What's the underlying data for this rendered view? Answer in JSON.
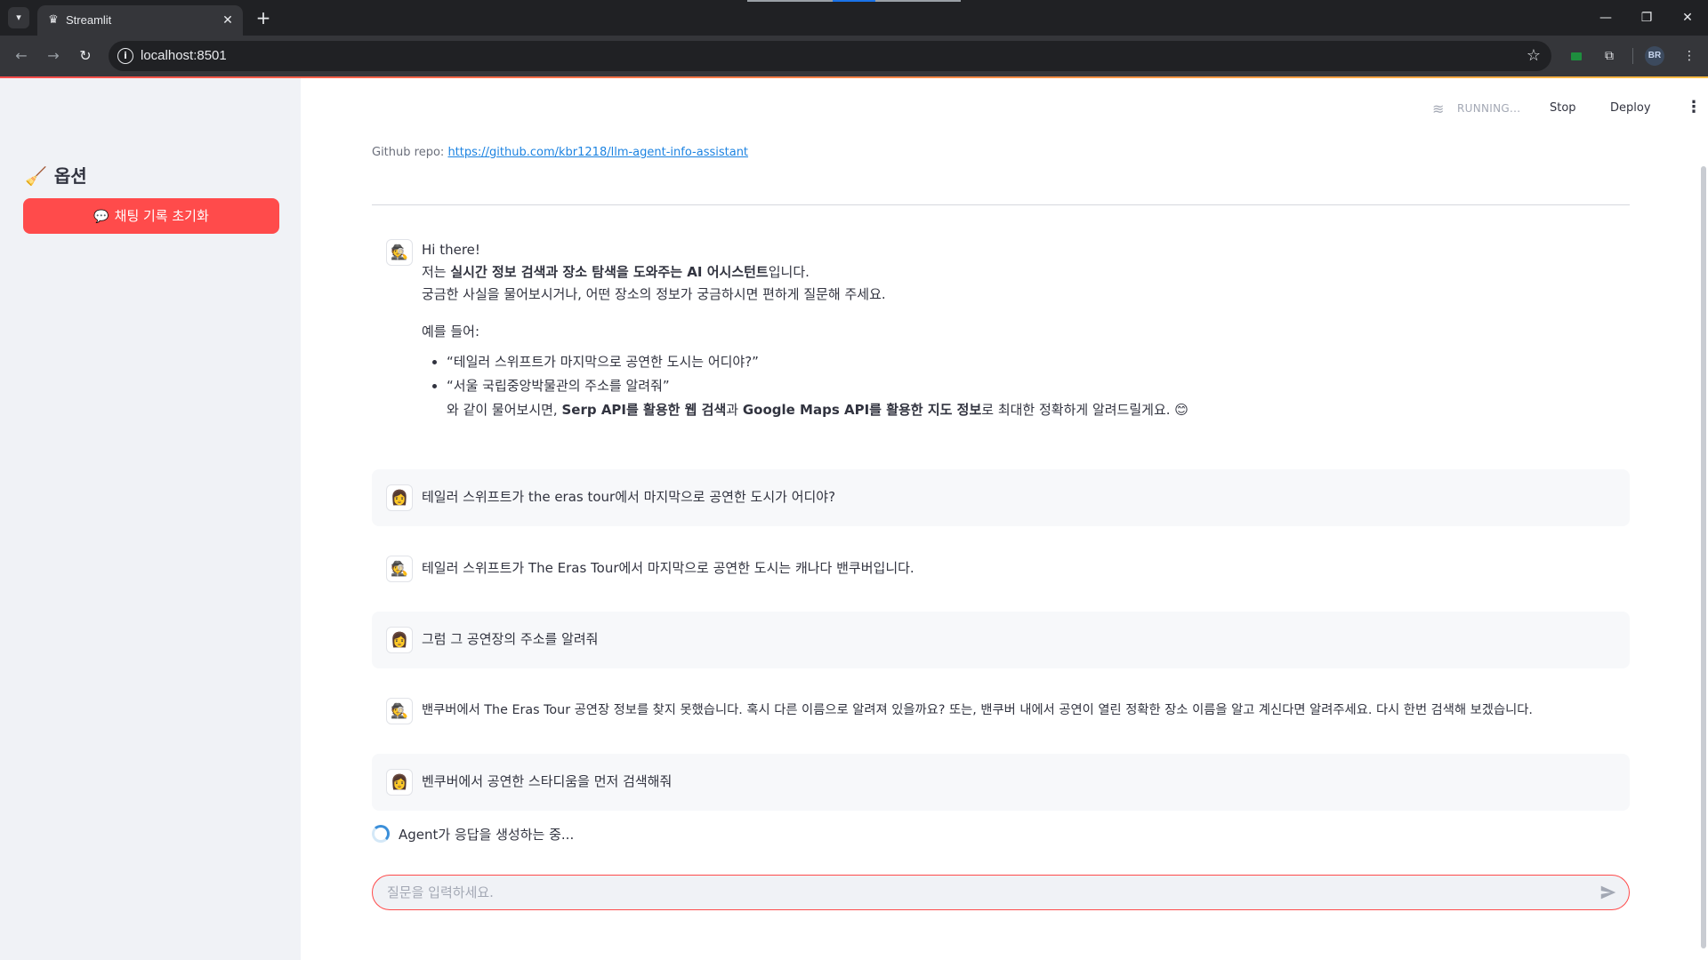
{
  "browser": {
    "tab_title": "Streamlit",
    "url": "localhost:8501",
    "profile_initials": "BR"
  },
  "sidebar": {
    "header": "옵션",
    "header_icon": "broom-icon",
    "reset_button_label": "채팅 기록 초기화",
    "reset_button_icon": "speech-balloon-icon"
  },
  "header": {
    "status": "RUNNING...",
    "stop_label": "Stop",
    "deploy_label": "Deploy"
  },
  "repo": {
    "label": "Github repo:",
    "link": "https://github.com/kbr1218/llm-agent-info-assistant"
  },
  "intro": {
    "greeting": "Hi there!",
    "line1_prefix": "저는 ",
    "line1_bold": "실시간 정보 검색과 장소 탐색을 도와주는 AI 어시스턴트",
    "line1_suffix": "입니다.",
    "line2": "궁금한 사실을 물어보시거나, 어떤 장소의 정보가 궁금하시면 편하게 질문해 주세요.",
    "examples_label": "예를 들어:",
    "example1": "“테일러 스위프트가 마지막으로 공연한 도시는 어디야?”",
    "example2": "“서울 국립중앙박물관의 주소를 알려줘”",
    "outro_prefix": "와 같이 물어보시면, ",
    "outro_bold1": "Serp API를 활용한 웹 검색",
    "outro_mid": "과 ",
    "outro_bold2": "Google Maps API를 활용한 지도 정보",
    "outro_suffix": "로 최대한 정확하게 알려드릴게요. 😊"
  },
  "messages": [
    {
      "role": "user",
      "text": "테일러 스위프트가 the eras tour에서 마지막으로 공연한 도시가 어디야?"
    },
    {
      "role": "assistant",
      "text": "테일러 스위프트가 The Eras Tour에서 마지막으로 공연한 도시는 캐나다 밴쿠버입니다."
    },
    {
      "role": "user",
      "text": "그럼 그 공연장의 주소를 알려줘"
    },
    {
      "role": "assistant",
      "text": "밴쿠버에서 The Eras Tour 공연장 정보를 찾지 못했습니다. 혹시 다른 이름으로 알려져 있을까요? 또는, 밴쿠버 내에서 공연이 열린 정확한 장소 이름을 알고 계신다면 알려주세요. 다시 한번 검색해 보겠습니다."
    },
    {
      "role": "user",
      "text": "벤쿠버에서 공연한 스타디움을 먼저 검색해줘"
    }
  ],
  "spinner_text": "Agent가 응답을 생성하는 중...",
  "chat_input": {
    "placeholder": "질문을 입력하세요.",
    "value": ""
  },
  "avatars": {
    "assistant": "detective-icon",
    "user": "woman-icon"
  },
  "colors": {
    "accent": "#ff4b4b",
    "link": "#1c83e1",
    "sidebar_bg": "#f0f2f6",
    "text": "#31333f"
  }
}
